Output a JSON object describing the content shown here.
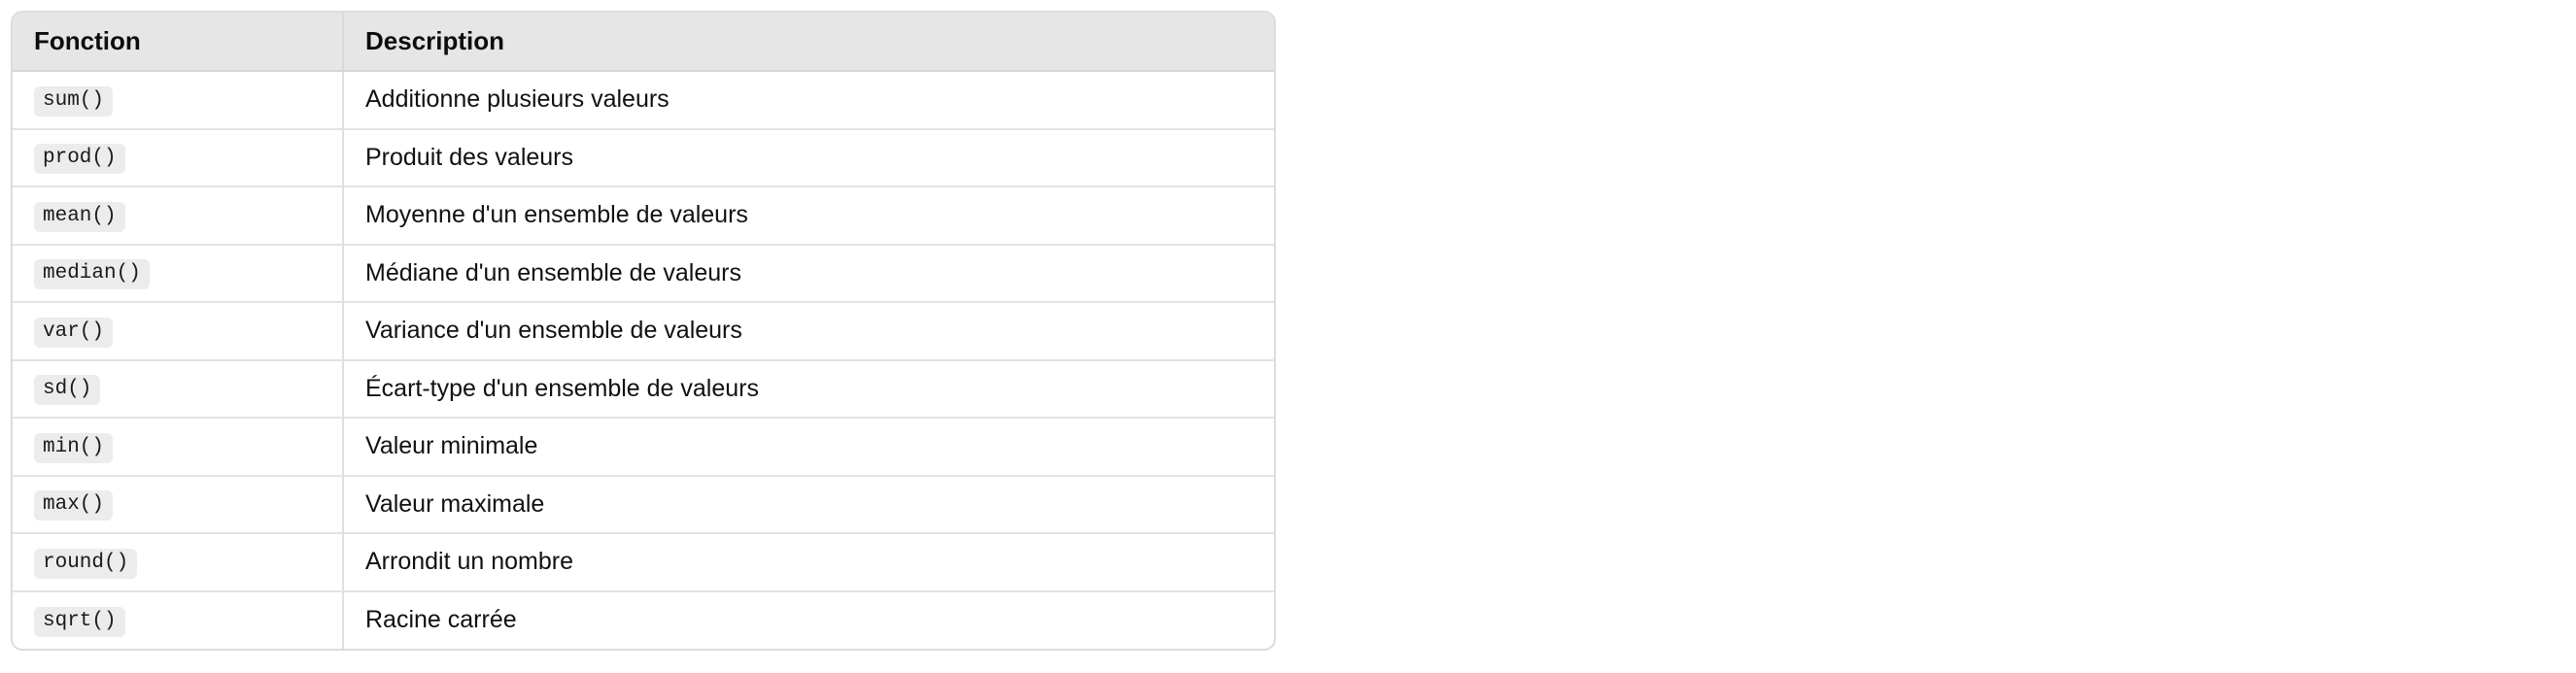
{
  "table": {
    "headers": {
      "function": "Fonction",
      "description": "Description"
    },
    "rows": [
      {
        "function": "sum()",
        "description": "Additionne plusieurs valeurs"
      },
      {
        "function": "prod()",
        "description": "Produit des valeurs"
      },
      {
        "function": "mean()",
        "description": "Moyenne d'un ensemble de valeurs"
      },
      {
        "function": "median()",
        "description": "Médiane d'un ensemble de valeurs"
      },
      {
        "function": "var()",
        "description": "Variance d'un ensemble de valeurs"
      },
      {
        "function": "sd()",
        "description": "Écart-type d'un ensemble de valeurs"
      },
      {
        "function": "min()",
        "description": "Valeur minimale"
      },
      {
        "function": "max()",
        "description": "Valeur maximale"
      },
      {
        "function": "round()",
        "description": "Arrondit un nombre"
      },
      {
        "function": "sqrt()",
        "description": "Racine carrée"
      }
    ]
  }
}
